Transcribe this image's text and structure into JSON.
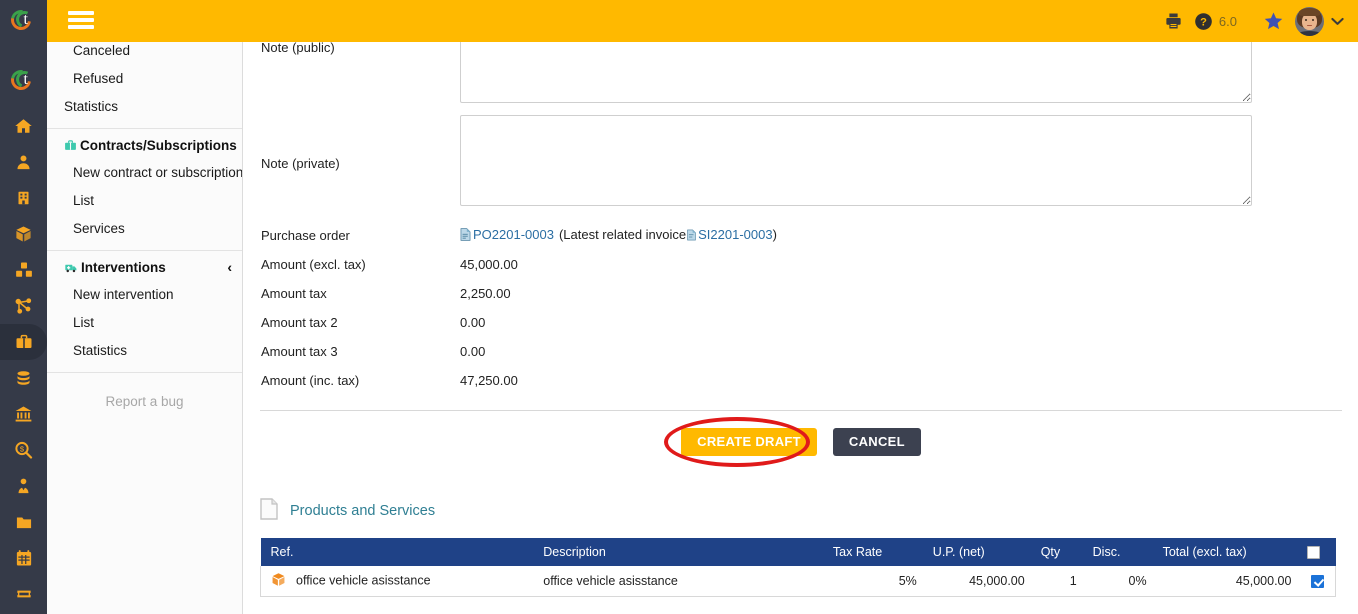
{
  "topbar": {
    "menu_toggle": "menu-toggle",
    "version": "6.0",
    "icons": [
      "print-icon",
      "help-icon",
      "star-icon",
      "avatar",
      "chevron-down-icon"
    ]
  },
  "icon_rail": {
    "logos": [
      "brand-logo-primary",
      "brand-logo-secondary"
    ],
    "items": [
      {
        "name": "home-icon",
        "active": false
      },
      {
        "name": "user-icon",
        "active": false
      },
      {
        "name": "building-icon",
        "active": false
      },
      {
        "name": "box-icon",
        "active": false
      },
      {
        "name": "boxes-icon",
        "active": false
      },
      {
        "name": "project-share-icon",
        "active": false
      },
      {
        "name": "briefcase-icon",
        "active": true
      },
      {
        "name": "money-stack-icon",
        "active": false
      },
      {
        "name": "bank-icon",
        "active": false
      },
      {
        "name": "money-search-icon",
        "active": false
      },
      {
        "name": "user-tie-icon",
        "active": false
      },
      {
        "name": "folder-icon",
        "active": false
      },
      {
        "name": "calendar-icon",
        "active": false
      },
      {
        "name": "ticket-icon",
        "active": false
      }
    ]
  },
  "sidebar": {
    "top_items": [
      {
        "label": "Canceled",
        "level": 2
      },
      {
        "label": "Refused",
        "level": 2
      },
      {
        "label": "Statistics",
        "level": 1
      }
    ],
    "sections": [
      {
        "icon": "contracts-icon",
        "title": "Contracts/Subscriptions",
        "chevron": "‹",
        "items": [
          {
            "label": "New contract or subscription"
          },
          {
            "label": "List"
          },
          {
            "label": "Services"
          }
        ]
      },
      {
        "icon": "interventions-icon",
        "title": "Interventions",
        "chevron": "‹",
        "items": [
          {
            "label": "New intervention"
          },
          {
            "label": "List"
          },
          {
            "label": "Statistics"
          }
        ]
      }
    ],
    "report_bug": "Report a bug"
  },
  "form": {
    "note_public": {
      "label": "Note (public)",
      "value": "",
      "placeholder": ""
    },
    "note_private": {
      "label": "Note (private)",
      "value": "",
      "placeholder": ""
    },
    "purchase_order": {
      "label": "Purchase order",
      "ref": "PO2201-0003",
      "paren_open": "(Latest related invoice",
      "invoice_ref": "SI2201-0003",
      "paren_close": ")"
    },
    "amounts": [
      {
        "label": "Amount (excl. tax)",
        "value": "45,000.00"
      },
      {
        "label": "Amount tax",
        "value": "2,250.00"
      },
      {
        "label": "Amount tax 2",
        "value": "0.00"
      },
      {
        "label": "Amount tax 3",
        "value": "0.00"
      },
      {
        "label": "Amount (inc. tax)",
        "value": "47,250.00"
      }
    ]
  },
  "actions": {
    "create_draft": "CREATE DRAFT",
    "cancel": "CANCEL",
    "highlight_color": "#e01a1a",
    "primary_color": "#ffb900"
  },
  "products_section": {
    "title": "Products and Services",
    "icon": "document-icon",
    "table": {
      "columns": [
        "Ref.",
        "Description",
        "Tax Rate",
        "U.P. (net)",
        "Qty",
        "Disc.",
        "Total (excl. tax)"
      ],
      "select_all_checked": false,
      "rows": [
        {
          "icon": "product-box-icon",
          "ref": "office vehicle asisstance",
          "description": "office vehicle asisstance",
          "tax_rate": "5%",
          "unit_price": "45,000.00",
          "qty": "1",
          "discount": "0%",
          "total_excl_tax": "45,000.00",
          "checked": true
        }
      ]
    }
  }
}
